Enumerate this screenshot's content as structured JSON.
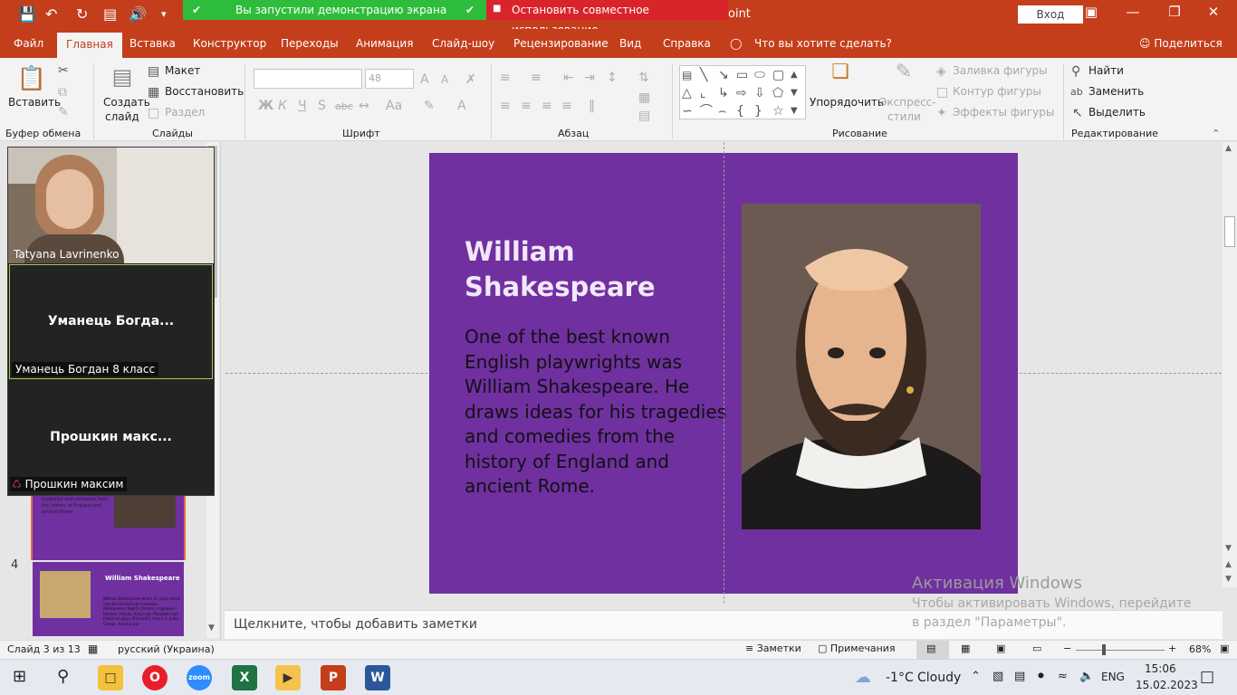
{
  "titlebar": {
    "share_notice": "Вы запустили демонстрацию экрана",
    "stop_share": "Остановить совместное использование",
    "app_suffix": "oint",
    "signin": "Вход"
  },
  "tabs": [
    "Файл",
    "Главная",
    "Вставка",
    "Конструктор",
    "Переходы",
    "Анимация",
    "Слайд-шоу",
    "Рецензирование",
    "Вид",
    "Справка"
  ],
  "tell_me": "Что вы хотите сделать?",
  "share": "Поделиться",
  "ribbon": {
    "clipboard": {
      "paste": "Вставить",
      "group": "Буфер обмена"
    },
    "slides": {
      "new_slide": "Создать",
      "new_slide_2": "слайд",
      "layout": "Макет",
      "reset": "Восстановить",
      "section": "Раздел",
      "group": "Слайды"
    },
    "font": {
      "size": "48",
      "bold": "Ж",
      "italic": "К",
      "underline": "Ч",
      "shadow": "S",
      "strike": "abc",
      "case": "Aa",
      "group": "Шрифт"
    },
    "paragraph": {
      "group": "Абзац"
    },
    "drawing": {
      "arrange": "Упорядочить",
      "quick_styles": "Экспресс-",
      "quick_styles_2": "стили",
      "fill": "Заливка фигуры",
      "outline": "Контур фигуры",
      "effects": "Эффекты фигуры",
      "group": "Рисование"
    },
    "editing": {
      "find": "Найти",
      "replace": "Заменить",
      "select": "Выделить",
      "group": "Редактирование"
    }
  },
  "thumbnails": [
    {
      "number": "4",
      "title": "William Shakespeare",
      "text": "William Shakespeare wrote 37 plays which may be divided into comedies (Midsummer Night's Dream), tragedies ( Hamlet, Othello, King Lear, Macbeth) and historical plays (Richard II, Henry V, Julius Caesar, Antony and"
    }
  ],
  "thumb3_text": "tragedies and comedies from the history of England and ancient Rome.",
  "slide": {
    "title": "William Shakespeare",
    "body": "One of the best known English playwrights was William Shakespeare. He draws ideas for his tragedies and comedies from the history of England and ancient Rome."
  },
  "notes_placeholder": "Щелкните, чтобы добавить заметки",
  "zoom": {
    "participant1": "Tatyana Lavrinenko",
    "participant2_center": "Уманець  Богда...",
    "participant2": "Уманець Богдан 8 класс",
    "participant3_center": "Прошкин  макс...",
    "participant3": "Прошкин максим"
  },
  "watermark": {
    "title": "Активация Windows",
    "text": "Чтобы активировать Windows, перейдите в раздел \"Параметры\"."
  },
  "status": {
    "slide": "Слайд 3 из 13",
    "language": "русский (Украина)",
    "notes": "Заметки",
    "comments": "Примечания",
    "zoom": "68%"
  },
  "taskbar": {
    "weather_temp": "-1°C",
    "weather_text": "Cloudy",
    "lang": "ENG",
    "time": "15:06",
    "date": "15.02.2023",
    "apps": [
      "File Explorer",
      "Opera",
      "Zoom",
      "Excel",
      "Video",
      "PowerPoint",
      "Word"
    ]
  },
  "colors": {
    "accent": "#c43e1c",
    "slide_bg": "#7030a0",
    "share_green": "#2ebd3b",
    "share_red": "#d9242b"
  }
}
